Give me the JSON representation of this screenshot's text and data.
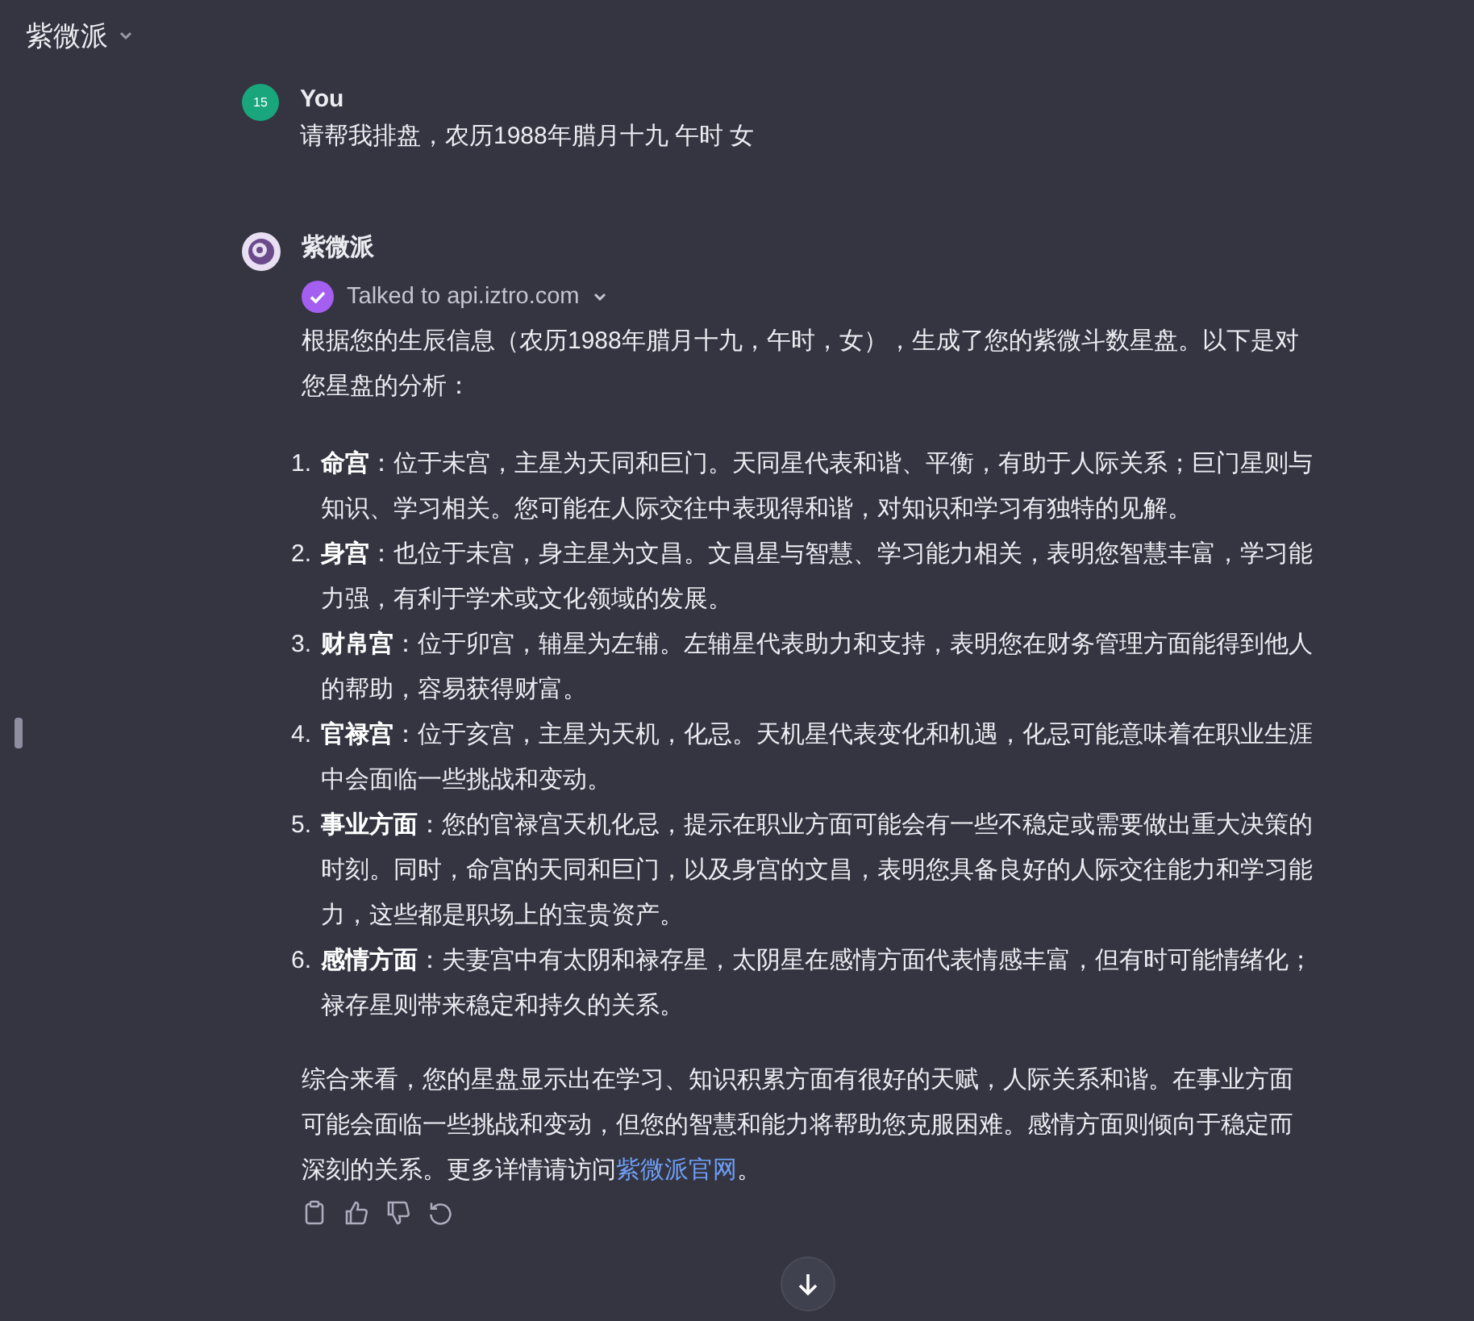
{
  "header": {
    "title": "紫微派"
  },
  "user_message": {
    "avatar": "15",
    "author": "You",
    "text": "请帮我排盘，农历1988年腊月十九 午时 女"
  },
  "assistant_message": {
    "author": "紫微派",
    "tool_call": "Talked to api.iztro.com",
    "intro": "根据您的生辰信息（农历1988年腊月十九，午时，女），生成了您的紫微斗数星盘。以下是对您星盘的分析：",
    "items": [
      {
        "number": "1.",
        "text": "**命宫**：位于未宫，主星为天同和巨门。天同星代表和谐、平衡，有助于人际关系；巨门星则与知识、学习相关。您可能在人际交往中表现得和谐，对知识和学习有独特的见解。"
      },
      {
        "number": "2.",
        "text": "**身宫**：也位于未宫，身主星为文昌。文昌星与智慧、学习能力相关，表明您智慧丰富，学习能力强，有利于学术或文化领域的发展。"
      },
      {
        "number": "3.",
        "text": "**财帛宫**：位于卯宫，辅星为左辅。左辅星代表助力和支持，表明您在财务管理方面能得到他人的帮助，容易获得财富。"
      },
      {
        "number": "4.",
        "text": "**官禄宫**：位于亥宫，主星为天机，化忌。天机星代表变化和机遇，化忌可能意味着在职业生涯中会面临一些挑战和变动。"
      },
      {
        "number": "5.",
        "text": "**事业方面**：您的官禄宫天机化忌，提示在职业方面可能会有一些不稳定或需要做出重大决策的时刻。同时，命宫的天同和巨门，以及身宫的文昌，表明您具备良好的人际交往能力和学习能力，这些都是职场上的宝贵资产。"
      },
      {
        "number": "6.",
        "text": "**感情方面**：夫妻宫中有太阴和禄存星，太阴星在感情方面代表情感丰富，但有时可能情绪化；禄存星则带来稳定和持久的关系。"
      }
    ],
    "summary": {
      "text": "综合来看，您的星盘显示出在学习、知识积累方面有很好的天赋，人际关系和谐。在事业方面可能会面临一些挑战和变动，但您的智慧和能力将帮助您克服困难。感情方面则倾向于稳定而深刻的关系。更多详情请访问",
      "link": "紫微派官网",
      "after": "。"
    }
  }
}
